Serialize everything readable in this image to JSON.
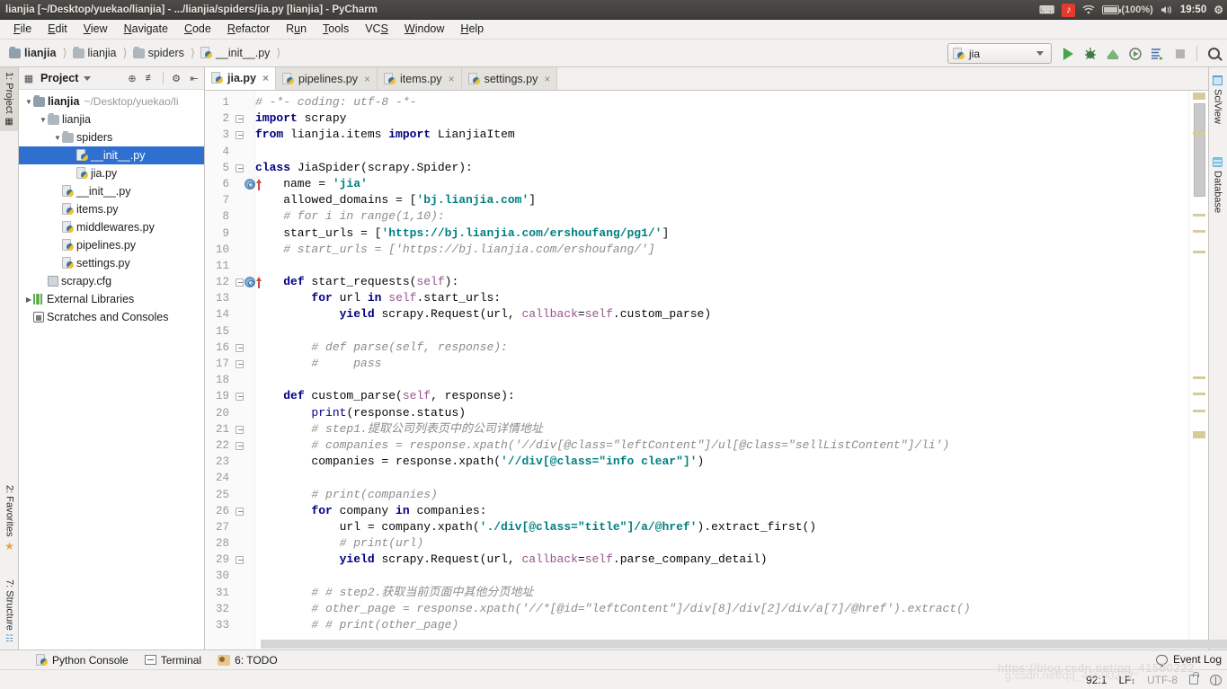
{
  "window": {
    "title": "lianjia [~/Desktop/yuekao/lianjia] - .../lianjia/spiders/jia.py [lianjia] - PyCharm"
  },
  "tray": {
    "keyboard_icon": "keyboard-icon",
    "music_icon": "music-icon",
    "music_glyph": "♪",
    "wifi_icon": "wifi-icon",
    "wifi_glyph": "●",
    "battery_label": "(100%)",
    "volume_glyph": "🔊",
    "clock": "19:50",
    "settings_glyph": "⚙"
  },
  "menubar": {
    "items": [
      {
        "label": "File"
      },
      {
        "label": "Edit"
      },
      {
        "label": "View"
      },
      {
        "label": "Navigate"
      },
      {
        "label": "Code"
      },
      {
        "label": "Refactor"
      },
      {
        "label": "Run"
      },
      {
        "label": "Tools"
      },
      {
        "label": "VCS"
      },
      {
        "label": "Window"
      },
      {
        "label": "Help"
      }
    ]
  },
  "navbar": {
    "breadcrumbs": [
      {
        "label": "lianjia",
        "icon": "folder-icon"
      },
      {
        "label": "lianjia",
        "icon": "folder-icon"
      },
      {
        "label": "spiders",
        "icon": "folder-icon"
      },
      {
        "label": "__init__.py",
        "icon": "python-file-icon"
      }
    ],
    "separator": "❯",
    "run_config": "jia",
    "buttons": [
      {
        "name": "run-button",
        "label": "Run"
      },
      {
        "name": "debug-button",
        "label": "Debug"
      },
      {
        "name": "run-coverage-button",
        "label": "Run with Coverage"
      },
      {
        "name": "profile-button",
        "label": "Profile"
      },
      {
        "name": "attach-button",
        "label": "Attach to Process"
      },
      {
        "name": "stop-button",
        "label": "Stop"
      },
      {
        "name": "search-everywhere-button",
        "label": "Search Everywhere"
      }
    ]
  },
  "left_strip": {
    "tabs": [
      {
        "label": "1: Project",
        "active": true,
        "icon": "project-icon"
      },
      {
        "label": "2: Favorites",
        "active": false,
        "icon": "star-icon"
      },
      {
        "label": "7: Structure",
        "active": false,
        "icon": "structure-icon"
      }
    ]
  },
  "right_strip": {
    "tabs": [
      {
        "label": "SciView",
        "icon": "grid-icon"
      },
      {
        "label": "Database",
        "icon": "database-icon"
      }
    ]
  },
  "project_panel": {
    "title": "Project",
    "toolbar_icons": [
      "target-icon",
      "collapse-icon",
      "gear-icon",
      "hide-icon"
    ],
    "tree": [
      {
        "depth": 0,
        "twisty": "▼",
        "icon": "folder-icon",
        "label": "lianjia",
        "path": "~/Desktop/yuekao/li",
        "bold": true,
        "selected": false
      },
      {
        "depth": 1,
        "twisty": "▼",
        "icon": "folder-icon",
        "label": "lianjia",
        "path": "",
        "bold": false,
        "selected": false
      },
      {
        "depth": 2,
        "twisty": "▼",
        "icon": "folder-icon",
        "label": "spiders",
        "path": "",
        "bold": false,
        "selected": false
      },
      {
        "depth": 3,
        "twisty": "",
        "icon": "python-file-icon",
        "label": "__init__.py",
        "path": "",
        "bold": false,
        "selected": true
      },
      {
        "depth": 3,
        "twisty": "",
        "icon": "python-file-icon",
        "label": "jia.py",
        "path": "",
        "bold": false,
        "selected": false
      },
      {
        "depth": 2,
        "twisty": "",
        "icon": "python-file-icon",
        "label": "__init__.py",
        "path": "",
        "bold": false,
        "selected": false
      },
      {
        "depth": 2,
        "twisty": "",
        "icon": "python-file-icon",
        "label": "items.py",
        "path": "",
        "bold": false,
        "selected": false
      },
      {
        "depth": 2,
        "twisty": "",
        "icon": "python-file-icon",
        "label": "middlewares.py",
        "path": "",
        "bold": false,
        "selected": false
      },
      {
        "depth": 2,
        "twisty": "",
        "icon": "python-file-icon",
        "label": "pipelines.py",
        "path": "",
        "bold": false,
        "selected": false
      },
      {
        "depth": 2,
        "twisty": "",
        "icon": "python-file-icon",
        "label": "settings.py",
        "path": "",
        "bold": false,
        "selected": false
      },
      {
        "depth": 1,
        "twisty": "",
        "icon": "config-file-icon",
        "label": "scrapy.cfg",
        "path": "",
        "bold": false,
        "selected": false
      },
      {
        "depth": 0,
        "twisty": "▶",
        "icon": "library-icon",
        "label": "External Libraries",
        "path": "",
        "bold": false,
        "selected": false
      },
      {
        "depth": 0,
        "twisty": "",
        "icon": "scratches-icon",
        "label": "Scratches and Consoles",
        "path": "",
        "bold": false,
        "selected": false
      }
    ]
  },
  "editor": {
    "tabs": [
      {
        "label": "jia.py",
        "active": true,
        "close": "×"
      },
      {
        "label": "pipelines.py",
        "active": false,
        "close": "×"
      },
      {
        "label": "items.py",
        "active": false,
        "close": "×"
      },
      {
        "label": "settings.py",
        "active": false,
        "close": "×"
      }
    ],
    "first_line": 1,
    "last_line": 33,
    "lines": [
      {
        "n": 1,
        "text": "# -*- coding: utf-8 -*-"
      },
      {
        "n": 2,
        "text": "import scrapy"
      },
      {
        "n": 3,
        "text": "from lianjia.items import LianjiaItem"
      },
      {
        "n": 4,
        "text": ""
      },
      {
        "n": 5,
        "text": "class JiaSpider(scrapy.Spider):"
      },
      {
        "n": 6,
        "text": "    name = 'jia'"
      },
      {
        "n": 7,
        "text": "    allowed_domains = ['bj.lianjia.com']"
      },
      {
        "n": 8,
        "text": "    # for i in range(1,10):"
      },
      {
        "n": 9,
        "text": "    start_urls = ['https://bj.lianjia.com/ershoufang/pg1/']"
      },
      {
        "n": 10,
        "text": "    # start_urls = ['https://bj.lianjia.com/ershoufang/']"
      },
      {
        "n": 11,
        "text": ""
      },
      {
        "n": 12,
        "text": "    def start_requests(self):"
      },
      {
        "n": 13,
        "text": "        for url in self.start_urls:"
      },
      {
        "n": 14,
        "text": "            yield scrapy.Request(url, callback=self.custom_parse)"
      },
      {
        "n": 15,
        "text": ""
      },
      {
        "n": 16,
        "text": "        # def parse(self, response):"
      },
      {
        "n": 17,
        "text": "        #     pass"
      },
      {
        "n": 18,
        "text": ""
      },
      {
        "n": 19,
        "text": "    def custom_parse(self, response):"
      },
      {
        "n": 20,
        "text": "        print(response.status)"
      },
      {
        "n": 21,
        "text": "        # step1.提取公司列表页中的公司详情地址"
      },
      {
        "n": 22,
        "text": "        # companies = response.xpath('//div[@class=\"leftContent\"]/ul[@class=\"sellListContent\"]/li')"
      },
      {
        "n": 23,
        "text": "        companies = response.xpath('//div[@class=\"info clear\"]')"
      },
      {
        "n": 24,
        "text": ""
      },
      {
        "n": 25,
        "text": "        # print(companies)"
      },
      {
        "n": 26,
        "text": "        for company in companies:"
      },
      {
        "n": 27,
        "text": "            url = company.xpath('./div[@class=\"title\"]/a/@href').extract_first()"
      },
      {
        "n": 28,
        "text": "            # print(url)"
      },
      {
        "n": 29,
        "text": "            yield scrapy.Request(url, callback=self.parse_company_detail)"
      },
      {
        "n": 30,
        "text": ""
      },
      {
        "n": 31,
        "text": "        # # step2.获取当前页面中其他分页地址"
      },
      {
        "n": 32,
        "text": "        # other_page = response.xpath('//*[@id=\"leftContent\"]/div[8]/div[2]/div/a[7]/@href').extract()"
      },
      {
        "n": 33,
        "text": "        # # print(other_page)"
      }
    ],
    "gutter_run_markers": [
      6,
      12
    ]
  },
  "toolwindow_bar": {
    "items": [
      {
        "label": "Python Console",
        "icon": "python-icon"
      },
      {
        "label": "Terminal",
        "icon": "terminal-icon"
      },
      {
        "label": "6: TODO",
        "icon": "todo-icon"
      }
    ],
    "event_log": "Event Log"
  },
  "statusbar": {
    "caret_position": "92:1",
    "line_separator": "LF",
    "encoding": "UTF-8",
    "lock_icon": "lock-icon",
    "inspection_icon": "inspections-icon"
  },
  "watermark": {
    "line1": "https://blog.csdn.net/qq_41500222",
    "line2": "g.csdn.net/qq_41500222"
  },
  "colors": {
    "selection_blue": "#2f6fd0",
    "keyword_navy": "#000080",
    "string_teal": "#008080",
    "comment_gray": "#8c8c8c",
    "self_purple": "#94558d",
    "titlebar_dark": "#413f3c",
    "panel_gray": "#f2f1f0"
  }
}
